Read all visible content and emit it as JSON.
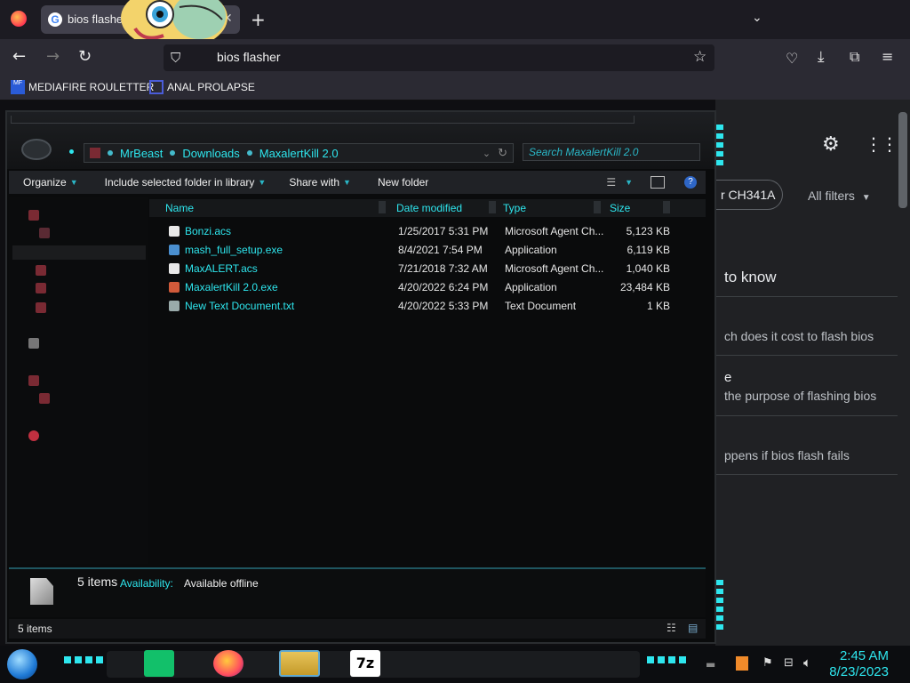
{
  "browser": {
    "tab_title": "bios flasher",
    "url": "bios flasher",
    "bookmarks": [
      "MEDIAFIRE ROULETTER",
      "ANAL PROLAPSE"
    ]
  },
  "google": {
    "chip": "r CH341A",
    "filters": "All filters",
    "section_title": "to know",
    "questions": [
      "ch does it cost to flash bios",
      "e",
      "the purpose of flashing bios",
      "ppens if bios flash fails"
    ]
  },
  "explorer": {
    "breadcrumb": [
      "MrBeast",
      "Downloads",
      "MaxalertKill 2.0"
    ],
    "search_placeholder": "Search MaxalertKill 2.0",
    "commands": [
      "Organize",
      "Include selected folder in library",
      "Share with",
      "New folder"
    ],
    "columns": [
      "Name",
      "Date modified",
      "Type",
      "Size"
    ],
    "files": [
      {
        "name": "Bonzi.acs",
        "date": "1/25/2017 5:31 PM",
        "type": "Microsoft Agent Ch...",
        "size": "5,123 KB",
        "icon": "agent-icon"
      },
      {
        "name": "mash_full_setup.exe",
        "date": "8/4/2021 7:54 PM",
        "type": "Application",
        "size": "6,119 KB",
        "icon": "setup-icon"
      },
      {
        "name": "MaxALERT.acs",
        "date": "7/21/2018 7:32 AM",
        "type": "Microsoft Agent Ch...",
        "size": "1,040 KB",
        "icon": "agent-icon"
      },
      {
        "name": "MaxalertKill 2.0.exe",
        "date": "4/20/2022 6:24 PM",
        "type": "Application",
        "size": "23,484 KB",
        "icon": "app-icon"
      },
      {
        "name": "New Text Document.txt",
        "date": "4/20/2022 5:33 PM",
        "type": "Text Document",
        "size": "1 KB",
        "icon": "text-file-icon"
      }
    ],
    "details": {
      "count": "5 items",
      "availability_label": "Availability:",
      "availability_value": "Available offline"
    },
    "status": "5 items"
  },
  "taskbar": {
    "time": "2:45 AM",
    "date": "8/23/2023",
    "apps": [
      "7z"
    ]
  }
}
